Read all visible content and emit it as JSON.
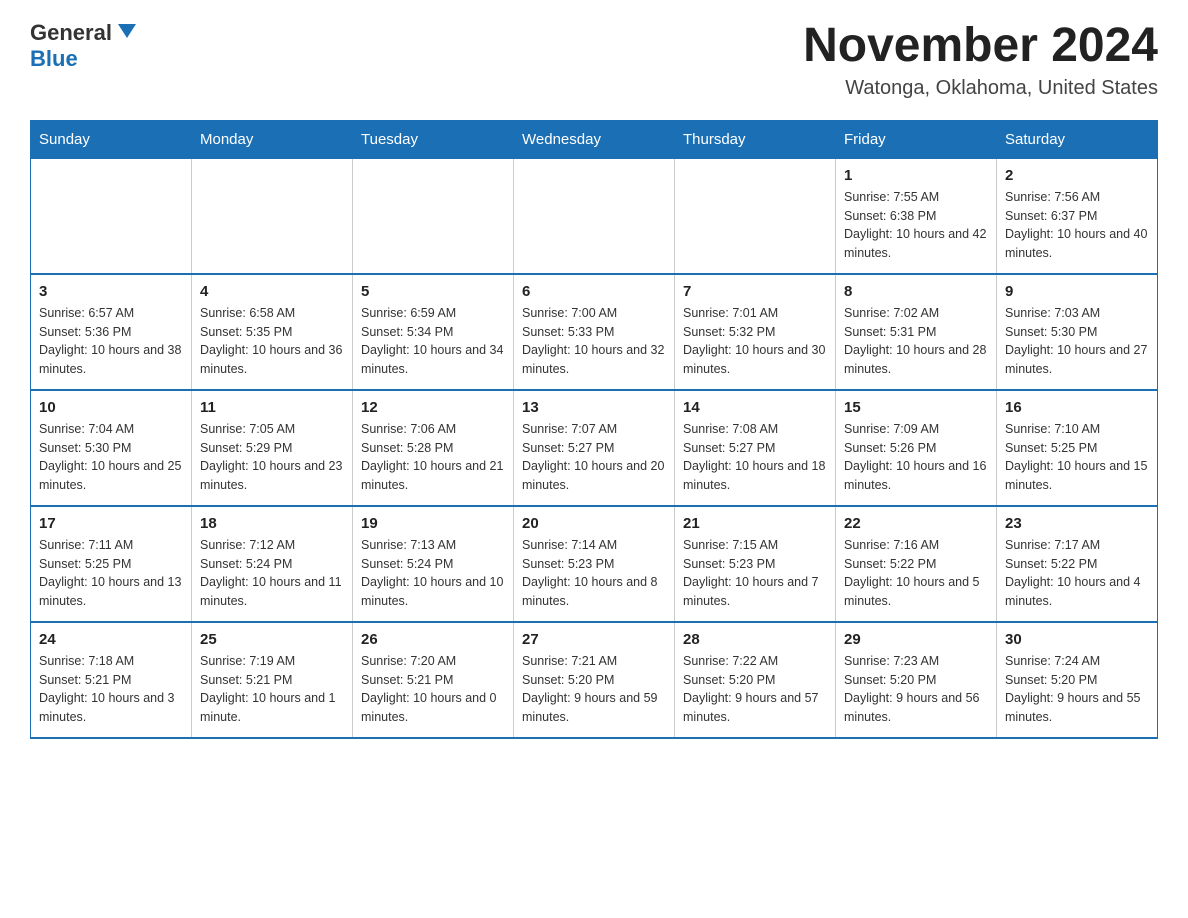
{
  "header": {
    "logo_general": "General",
    "logo_blue": "Blue",
    "title": "November 2024",
    "subtitle": "Watonga, Oklahoma, United States"
  },
  "days_of_week": [
    "Sunday",
    "Monday",
    "Tuesday",
    "Wednesday",
    "Thursday",
    "Friday",
    "Saturday"
  ],
  "weeks": [
    [
      {
        "num": "",
        "sunrise": "",
        "sunset": "",
        "daylight": ""
      },
      {
        "num": "",
        "sunrise": "",
        "sunset": "",
        "daylight": ""
      },
      {
        "num": "",
        "sunrise": "",
        "sunset": "",
        "daylight": ""
      },
      {
        "num": "",
        "sunrise": "",
        "sunset": "",
        "daylight": ""
      },
      {
        "num": "",
        "sunrise": "",
        "sunset": "",
        "daylight": ""
      },
      {
        "num": "1",
        "sunrise": "Sunrise: 7:55 AM",
        "sunset": "Sunset: 6:38 PM",
        "daylight": "Daylight: 10 hours and 42 minutes."
      },
      {
        "num": "2",
        "sunrise": "Sunrise: 7:56 AM",
        "sunset": "Sunset: 6:37 PM",
        "daylight": "Daylight: 10 hours and 40 minutes."
      }
    ],
    [
      {
        "num": "3",
        "sunrise": "Sunrise: 6:57 AM",
        "sunset": "Sunset: 5:36 PM",
        "daylight": "Daylight: 10 hours and 38 minutes."
      },
      {
        "num": "4",
        "sunrise": "Sunrise: 6:58 AM",
        "sunset": "Sunset: 5:35 PM",
        "daylight": "Daylight: 10 hours and 36 minutes."
      },
      {
        "num": "5",
        "sunrise": "Sunrise: 6:59 AM",
        "sunset": "Sunset: 5:34 PM",
        "daylight": "Daylight: 10 hours and 34 minutes."
      },
      {
        "num": "6",
        "sunrise": "Sunrise: 7:00 AM",
        "sunset": "Sunset: 5:33 PM",
        "daylight": "Daylight: 10 hours and 32 minutes."
      },
      {
        "num": "7",
        "sunrise": "Sunrise: 7:01 AM",
        "sunset": "Sunset: 5:32 PM",
        "daylight": "Daylight: 10 hours and 30 minutes."
      },
      {
        "num": "8",
        "sunrise": "Sunrise: 7:02 AM",
        "sunset": "Sunset: 5:31 PM",
        "daylight": "Daylight: 10 hours and 28 minutes."
      },
      {
        "num": "9",
        "sunrise": "Sunrise: 7:03 AM",
        "sunset": "Sunset: 5:30 PM",
        "daylight": "Daylight: 10 hours and 27 minutes."
      }
    ],
    [
      {
        "num": "10",
        "sunrise": "Sunrise: 7:04 AM",
        "sunset": "Sunset: 5:30 PM",
        "daylight": "Daylight: 10 hours and 25 minutes."
      },
      {
        "num": "11",
        "sunrise": "Sunrise: 7:05 AM",
        "sunset": "Sunset: 5:29 PM",
        "daylight": "Daylight: 10 hours and 23 minutes."
      },
      {
        "num": "12",
        "sunrise": "Sunrise: 7:06 AM",
        "sunset": "Sunset: 5:28 PM",
        "daylight": "Daylight: 10 hours and 21 minutes."
      },
      {
        "num": "13",
        "sunrise": "Sunrise: 7:07 AM",
        "sunset": "Sunset: 5:27 PM",
        "daylight": "Daylight: 10 hours and 20 minutes."
      },
      {
        "num": "14",
        "sunrise": "Sunrise: 7:08 AM",
        "sunset": "Sunset: 5:27 PM",
        "daylight": "Daylight: 10 hours and 18 minutes."
      },
      {
        "num": "15",
        "sunrise": "Sunrise: 7:09 AM",
        "sunset": "Sunset: 5:26 PM",
        "daylight": "Daylight: 10 hours and 16 minutes."
      },
      {
        "num": "16",
        "sunrise": "Sunrise: 7:10 AM",
        "sunset": "Sunset: 5:25 PM",
        "daylight": "Daylight: 10 hours and 15 minutes."
      }
    ],
    [
      {
        "num": "17",
        "sunrise": "Sunrise: 7:11 AM",
        "sunset": "Sunset: 5:25 PM",
        "daylight": "Daylight: 10 hours and 13 minutes."
      },
      {
        "num": "18",
        "sunrise": "Sunrise: 7:12 AM",
        "sunset": "Sunset: 5:24 PM",
        "daylight": "Daylight: 10 hours and 11 minutes."
      },
      {
        "num": "19",
        "sunrise": "Sunrise: 7:13 AM",
        "sunset": "Sunset: 5:24 PM",
        "daylight": "Daylight: 10 hours and 10 minutes."
      },
      {
        "num": "20",
        "sunrise": "Sunrise: 7:14 AM",
        "sunset": "Sunset: 5:23 PM",
        "daylight": "Daylight: 10 hours and 8 minutes."
      },
      {
        "num": "21",
        "sunrise": "Sunrise: 7:15 AM",
        "sunset": "Sunset: 5:23 PM",
        "daylight": "Daylight: 10 hours and 7 minutes."
      },
      {
        "num": "22",
        "sunrise": "Sunrise: 7:16 AM",
        "sunset": "Sunset: 5:22 PM",
        "daylight": "Daylight: 10 hours and 5 minutes."
      },
      {
        "num": "23",
        "sunrise": "Sunrise: 7:17 AM",
        "sunset": "Sunset: 5:22 PM",
        "daylight": "Daylight: 10 hours and 4 minutes."
      }
    ],
    [
      {
        "num": "24",
        "sunrise": "Sunrise: 7:18 AM",
        "sunset": "Sunset: 5:21 PM",
        "daylight": "Daylight: 10 hours and 3 minutes."
      },
      {
        "num": "25",
        "sunrise": "Sunrise: 7:19 AM",
        "sunset": "Sunset: 5:21 PM",
        "daylight": "Daylight: 10 hours and 1 minute."
      },
      {
        "num": "26",
        "sunrise": "Sunrise: 7:20 AM",
        "sunset": "Sunset: 5:21 PM",
        "daylight": "Daylight: 10 hours and 0 minutes."
      },
      {
        "num": "27",
        "sunrise": "Sunrise: 7:21 AM",
        "sunset": "Sunset: 5:20 PM",
        "daylight": "Daylight: 9 hours and 59 minutes."
      },
      {
        "num": "28",
        "sunrise": "Sunrise: 7:22 AM",
        "sunset": "Sunset: 5:20 PM",
        "daylight": "Daylight: 9 hours and 57 minutes."
      },
      {
        "num": "29",
        "sunrise": "Sunrise: 7:23 AM",
        "sunset": "Sunset: 5:20 PM",
        "daylight": "Daylight: 9 hours and 56 minutes."
      },
      {
        "num": "30",
        "sunrise": "Sunrise: 7:24 AM",
        "sunset": "Sunset: 5:20 PM",
        "daylight": "Daylight: 9 hours and 55 minutes."
      }
    ]
  ]
}
